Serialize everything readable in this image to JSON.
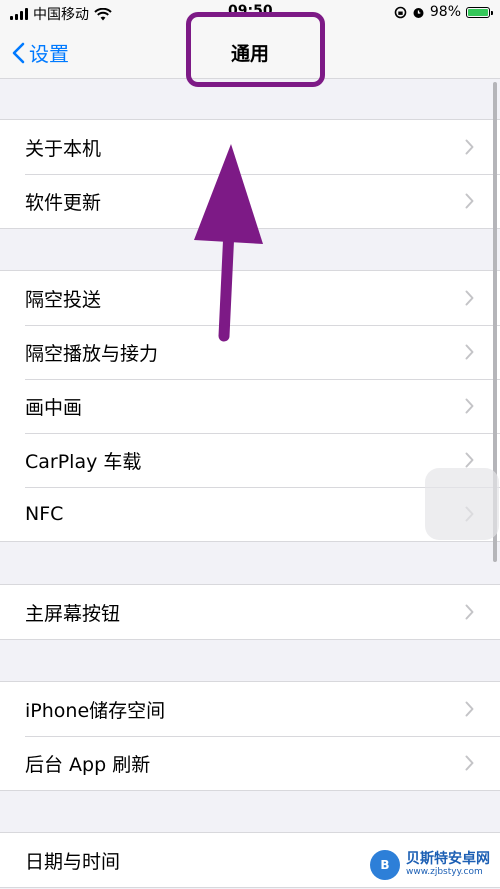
{
  "status_bar": {
    "carrier": "中国移动",
    "time": "09:50",
    "battery_percent": "98%",
    "wifi_icon": "wifi-icon",
    "alarm_icon": "alarm-icon",
    "lock_icon": "rotation-lock-icon"
  },
  "nav": {
    "back_label": "设置",
    "title": "通用"
  },
  "groups": [
    {
      "items": [
        "关于本机",
        "软件更新"
      ]
    },
    {
      "items": [
        "隔空投送",
        "隔空播放与接力",
        "画中画",
        "CarPlay 车载",
        "NFC"
      ]
    },
    {
      "items": [
        "主屏幕按钮"
      ]
    },
    {
      "items": [
        "iPhone储存空间",
        "后台 App 刷新"
      ]
    },
    {
      "items": [
        "日期与时间"
      ]
    }
  ],
  "annotation": {
    "color": "#7d1a86"
  },
  "watermark": {
    "title": "贝斯特安卓网",
    "url": "www.zjbstyy.com"
  },
  "colors": {
    "accent": "#007aff",
    "battery": "#34c759"
  }
}
